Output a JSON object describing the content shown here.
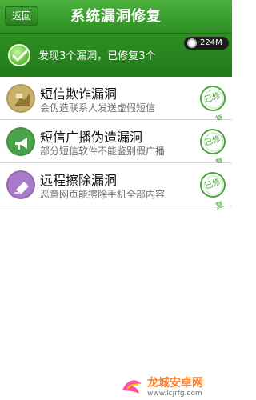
{
  "header": {
    "back_label": "返回",
    "title": "系统漏洞修复"
  },
  "summary": {
    "text": "发现3个漏洞，已修复3个",
    "memory": "224M"
  },
  "items": [
    {
      "title": "短信欺诈漏洞",
      "description": "会伪造联系人发送虚假短信",
      "status": "已修复",
      "icon": "message-fraud-icon",
      "icon_color": "#c9b16a"
    },
    {
      "title": "短信广播伪造漏洞",
      "description": "部分短信软件不能鉴别假广播",
      "status": "已修复",
      "icon": "broadcast-megaphone-icon",
      "icon_color": "#4aa34a"
    },
    {
      "title": "远程擦除漏洞",
      "description": "恶意网页能擦除手机全部内容",
      "status": "已修复",
      "icon": "remote-wipe-icon",
      "icon_color": "#a87ac7"
    }
  ],
  "watermark": {
    "title": "龙城安卓网",
    "url": "www.lcjrfg.com"
  }
}
